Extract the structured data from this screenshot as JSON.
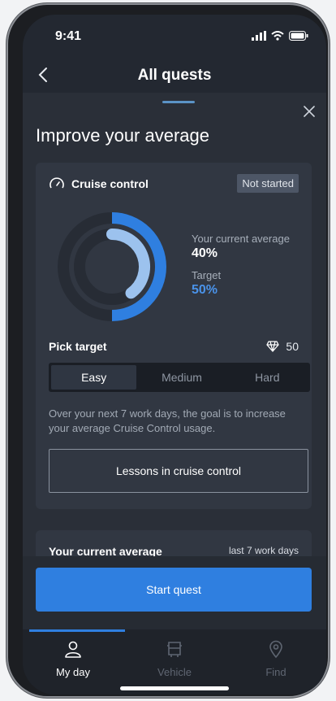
{
  "status_bar": {
    "time": "9:41"
  },
  "navbar": {
    "title": "All quests"
  },
  "sheet": {
    "title": "Improve your average"
  },
  "quest": {
    "name": "Cruise control",
    "status": "Not started",
    "current_average_label": "Your current average",
    "current_average_value": "40%",
    "target_label": "Target",
    "target_value": "50%",
    "current_fraction": 0.4,
    "target_fraction": 0.5,
    "pick_target_label": "Pick target",
    "reward": "50",
    "difficulties": [
      "Easy",
      "Medium",
      "Hard"
    ],
    "selected_difficulty": "Easy",
    "description": "Over your next 7 work days, the goal is to increase your average Cruise Control usage.",
    "lessons_button": "Lessons in cruise control"
  },
  "stats": {
    "title": "Your current average",
    "period": "last 7 work days"
  },
  "cta": {
    "label": "Start quest"
  },
  "tabbar": {
    "tabs": [
      {
        "label": "My day",
        "icon": "person-icon",
        "active": true
      },
      {
        "label": "Vehicle",
        "icon": "vehicle-icon",
        "active": false
      },
      {
        "label": "Find",
        "icon": "location-pin-icon",
        "active": false
      }
    ]
  },
  "colors": {
    "accent": "#2f7fe0",
    "ring_light": "#9cc2ee",
    "background": "#232831"
  }
}
